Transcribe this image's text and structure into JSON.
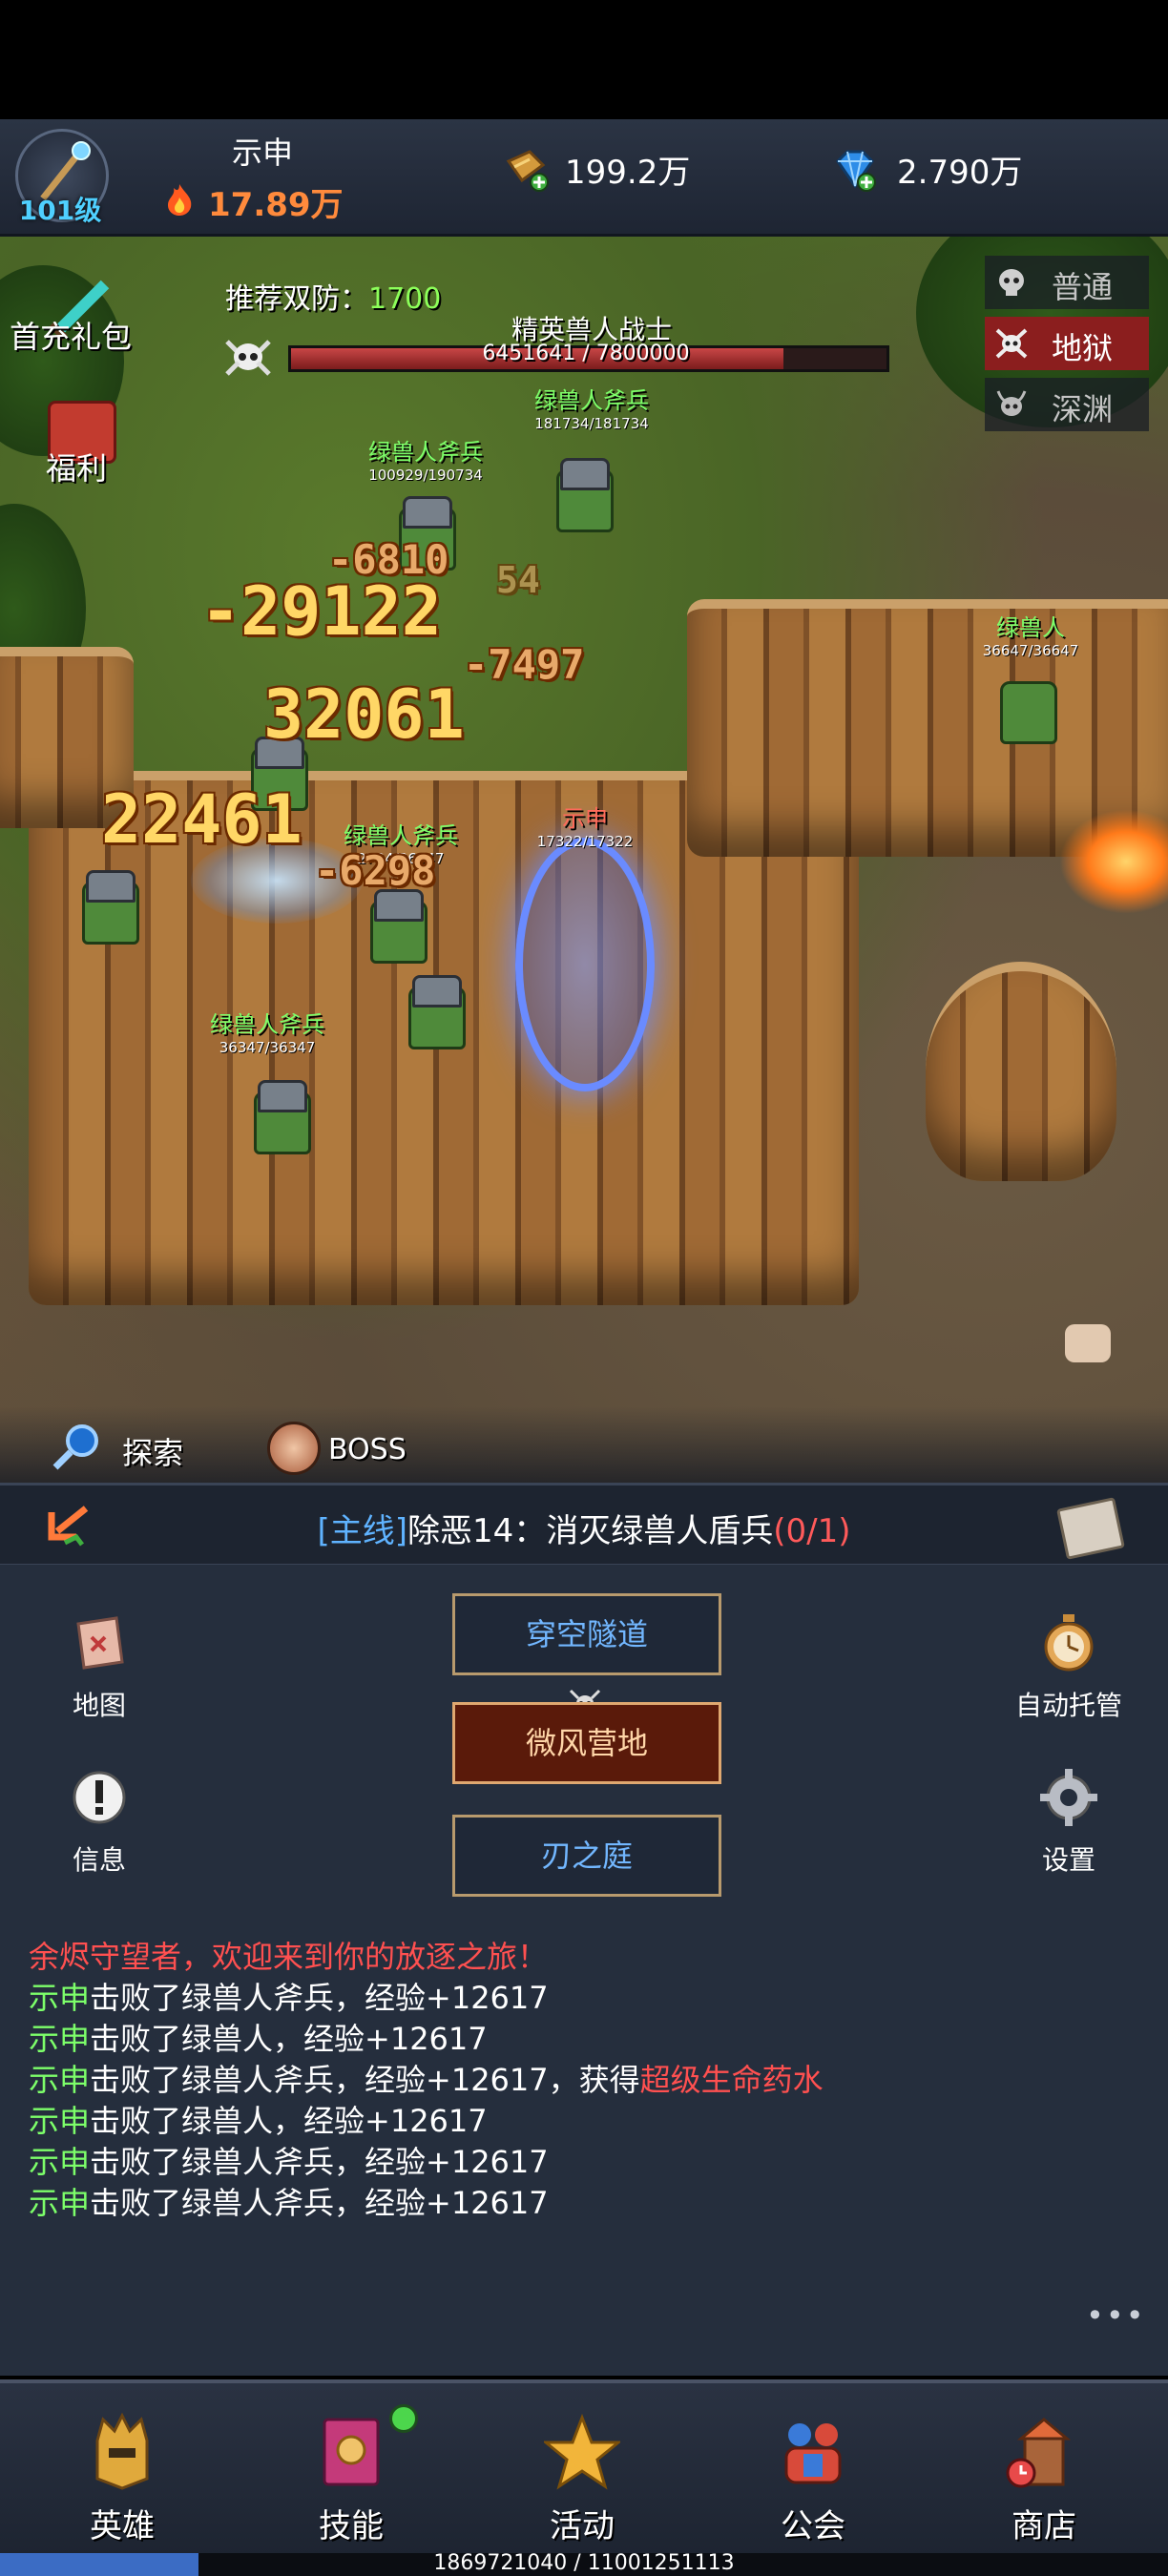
{
  "header": {
    "player_name": "示申",
    "level": "101级",
    "power": "17.89万",
    "gold": "199.2万",
    "gems": "2.790万"
  },
  "battle": {
    "gift_label": "首充礼包",
    "welfare_label": "福利",
    "recommend_label": "推荐双防：",
    "recommend_value": "1700",
    "boss": {
      "name": "精英兽人战士",
      "hp_text": "6451641 / 7800000",
      "hp_fraction": 0.827
    },
    "difficulties": [
      {
        "label": "普通",
        "active": false
      },
      {
        "label": "地狱",
        "active": true
      },
      {
        "label": "深渊",
        "active": false
      }
    ],
    "enemies": [
      {
        "name": "绿兽人斧兵",
        "hp": "181734/181734"
      },
      {
        "name": "绿兽人斧兵",
        "hp": "100929/190734"
      },
      {
        "name": "绿兽人",
        "hp": "36647/36647"
      },
      {
        "name": "绿兽人斧兵",
        "hp": "36347/36347"
      },
      {
        "name": "绿兽人斧兵",
        "hp": "2704/36347"
      },
      {
        "name": "示申",
        "hp": "17322/17322"
      }
    ],
    "damage_numbers": [
      "-29122",
      "32061",
      "22461",
      "-6810",
      "-7497",
      "-6298",
      "54"
    ],
    "explore_label": "探索",
    "boss_button_label": "BOSS"
  },
  "quest": {
    "tag": "[主线]",
    "text": "除恶14：消灭绿兽人盾兵",
    "progress": "(0/1)"
  },
  "map": {
    "left_buttons": [
      {
        "label": "地图"
      },
      {
        "label": "信息"
      }
    ],
    "right_buttons": [
      {
        "label": "自动托管"
      },
      {
        "label": "设置"
      }
    ],
    "zones": [
      {
        "label": "穿空隧道",
        "current": false
      },
      {
        "label": "微风营地",
        "current": true
      },
      {
        "label": "刃之庭",
        "current": false
      }
    ]
  },
  "log": [
    {
      "a": "余烬守望者，欢迎来到你的放逐之旅！",
      "a_color": "red"
    },
    {
      "a": "示申",
      "b": "击败了绿兽人斧兵，经验+12617"
    },
    {
      "a": "示申",
      "b": "击败了绿兽人，经验+12617"
    },
    {
      "a": "示申",
      "b": "击败了绿兽人斧兵，经验+12617，获得",
      "c": "超级生命药水"
    },
    {
      "a": "示申",
      "b": "击败了绿兽人，经验+12617"
    },
    {
      "a": "示申",
      "b": "击败了绿兽人斧兵，经验+12617"
    },
    {
      "a": "示申",
      "b": "击败了绿兽人斧兵，经验+12617"
    }
  ],
  "more": "•••",
  "nav": [
    {
      "label": "英雄",
      "icon": "helmet-icon"
    },
    {
      "label": "技能",
      "icon": "spellbook-icon"
    },
    {
      "label": "活动",
      "icon": "star-icon"
    },
    {
      "label": "公会",
      "icon": "guild-icon"
    },
    {
      "label": "商店",
      "icon": "shop-icon"
    }
  ],
  "footer": {
    "text": "1869721040 / 11001251113",
    "progress_fraction": 0.17
  },
  "colors": {
    "accent_blue": "#5fb3ff",
    "green": "#7dff6a",
    "red": "#ff5050",
    "power_orange": "#ff8a3c"
  }
}
